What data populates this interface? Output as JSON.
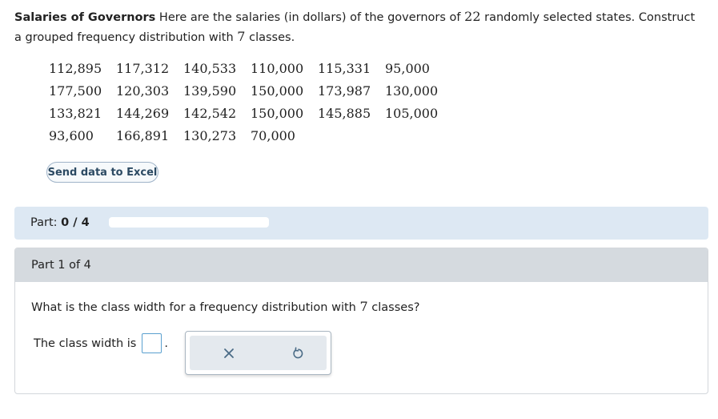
{
  "problem": {
    "title": "Salaries of Governors",
    "text_before_n": " Here are the salaries (in dollars) of the governors of ",
    "n": "22",
    "text_after_n": " randomly selected states. Construct a grouped frequency distribution with ",
    "classes": "7",
    "text_end": " classes."
  },
  "data_rows": [
    [
      "112,895",
      "117,312",
      "140,533",
      "110,000",
      "115,331",
      "95,000"
    ],
    [
      "177,500",
      "120,303",
      "139,590",
      "150,000",
      "173,987",
      "130,000"
    ],
    [
      "133,821",
      "144,269",
      "142,542",
      "150,000",
      "145,885",
      "105,000"
    ],
    [
      "93,600",
      "166,891",
      "130,273",
      "70,000",
      "",
      ""
    ]
  ],
  "excel_button": "Send data to Excel",
  "progress": {
    "label": "Part:",
    "value": "0 / 4",
    "fraction": 0
  },
  "part": {
    "header": "Part 1 of 4",
    "question_before": "What is the class width for a frequency distribution with ",
    "question_classes": "7",
    "question_after": " classes?",
    "answer_label": "The class width is",
    "answer_suffix": "."
  },
  "tools": {
    "clear_icon": "close-icon",
    "reset_icon": "undo-icon"
  },
  "colors": {
    "progress_bg": "#dde8f3",
    "part_header_bg": "#d5dadf",
    "input_border": "#5aa0cf"
  }
}
